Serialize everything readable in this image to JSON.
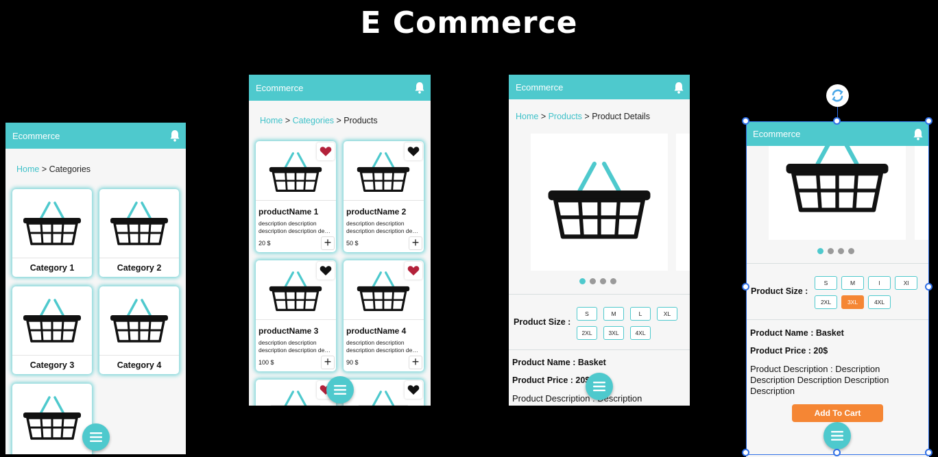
{
  "page": {
    "title": "E Commerce"
  },
  "screens": {
    "categories": {
      "app_title": "Ecommerce",
      "crumb_home": "Home",
      "crumb_current": "Categories",
      "items": [
        "Category 1",
        "Category 2",
        "Category 3",
        "Category 4"
      ]
    },
    "products": {
      "app_title": "Ecommerce",
      "crumb_home": "Home",
      "crumb_categories": "Categories",
      "crumb_current": "Products",
      "items": [
        {
          "name": "productName 1",
          "desc1": "description description",
          "desc2": "description description description",
          "price": "20 $",
          "favorite": true
        },
        {
          "name": "productName 2",
          "desc1": "description description",
          "desc2": "description description description",
          "price": "50 $",
          "favorite": false
        },
        {
          "name": "productName 3",
          "desc1": "description description",
          "desc2": "description description description",
          "price": "100 $",
          "favorite": false
        },
        {
          "name": "productName 4",
          "desc1": "description description",
          "desc2": "description description description",
          "price": "90 $",
          "favorite": true
        }
      ]
    },
    "details": {
      "app_title": "Ecommerce",
      "crumb_home": "Home",
      "crumb_products": "Products",
      "crumb_current": "Product Details",
      "size_label": "Product Size :",
      "sizes_row1": [
        "S",
        "M",
        "L",
        "XL"
      ],
      "sizes_row2": [
        "2XL",
        "3XL",
        "4XL"
      ],
      "name_line": "Product Name : Basket",
      "price_line": "Product Price : 20$",
      "desc_line": "Product Description : Description"
    },
    "details_scrolled": {
      "app_title": "Ecommerce",
      "size_label": "Product Size :",
      "sizes_row1": [
        "S",
        "M",
        "l",
        "Xl"
      ],
      "sizes_row2": [
        "2XL",
        "3XL",
        "4XL"
      ],
      "selected_size": "3XL",
      "name_line": "Product Name : Basket",
      "price_line": "Product Price : 20$",
      "desc_line1": "Product Description : Description",
      "desc_line2": "Description Description Description",
      "desc_line3": "Description",
      "add_to_cart": "Add To Cart"
    }
  },
  "colors": {
    "accent": "#4ec9cd",
    "heart_red": "#b3213a",
    "cta_orange": "#f58634",
    "background": "#000000"
  },
  "icons": [
    "bell-icon",
    "basket-icon",
    "heart-icon",
    "plus-icon",
    "menu-icon",
    "rotate-icon"
  ]
}
